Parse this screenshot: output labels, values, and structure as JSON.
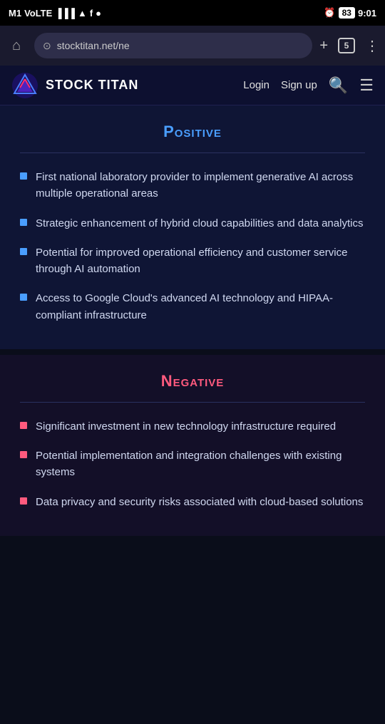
{
  "statusBar": {
    "carrier": "M1",
    "volte": "VoLTE",
    "time": "9:01",
    "battery": "83"
  },
  "browserBar": {
    "url": "stocktitan.net/ne",
    "tabCount": "5"
  },
  "nav": {
    "brand": "STOCK TITAN",
    "loginLabel": "Login",
    "signupLabel": "Sign up"
  },
  "sections": {
    "positive": {
      "title": "Positive",
      "bullets": [
        "First national laboratory provider to implement generative AI across multiple operational areas",
        "Strategic enhancement of hybrid cloud capabilities and data analytics",
        "Potential for improved operational efficiency and customer service through AI automation",
        "Access to Google Cloud's advanced AI technology and HIPAA-compliant infrastructure"
      ]
    },
    "negative": {
      "title": "Negative",
      "bullets": [
        "Significant investment in new technology infrastructure required",
        "Potential implementation and integration challenges with existing systems",
        "Data privacy and security risks associated with cloud-based solutions"
      ]
    }
  }
}
